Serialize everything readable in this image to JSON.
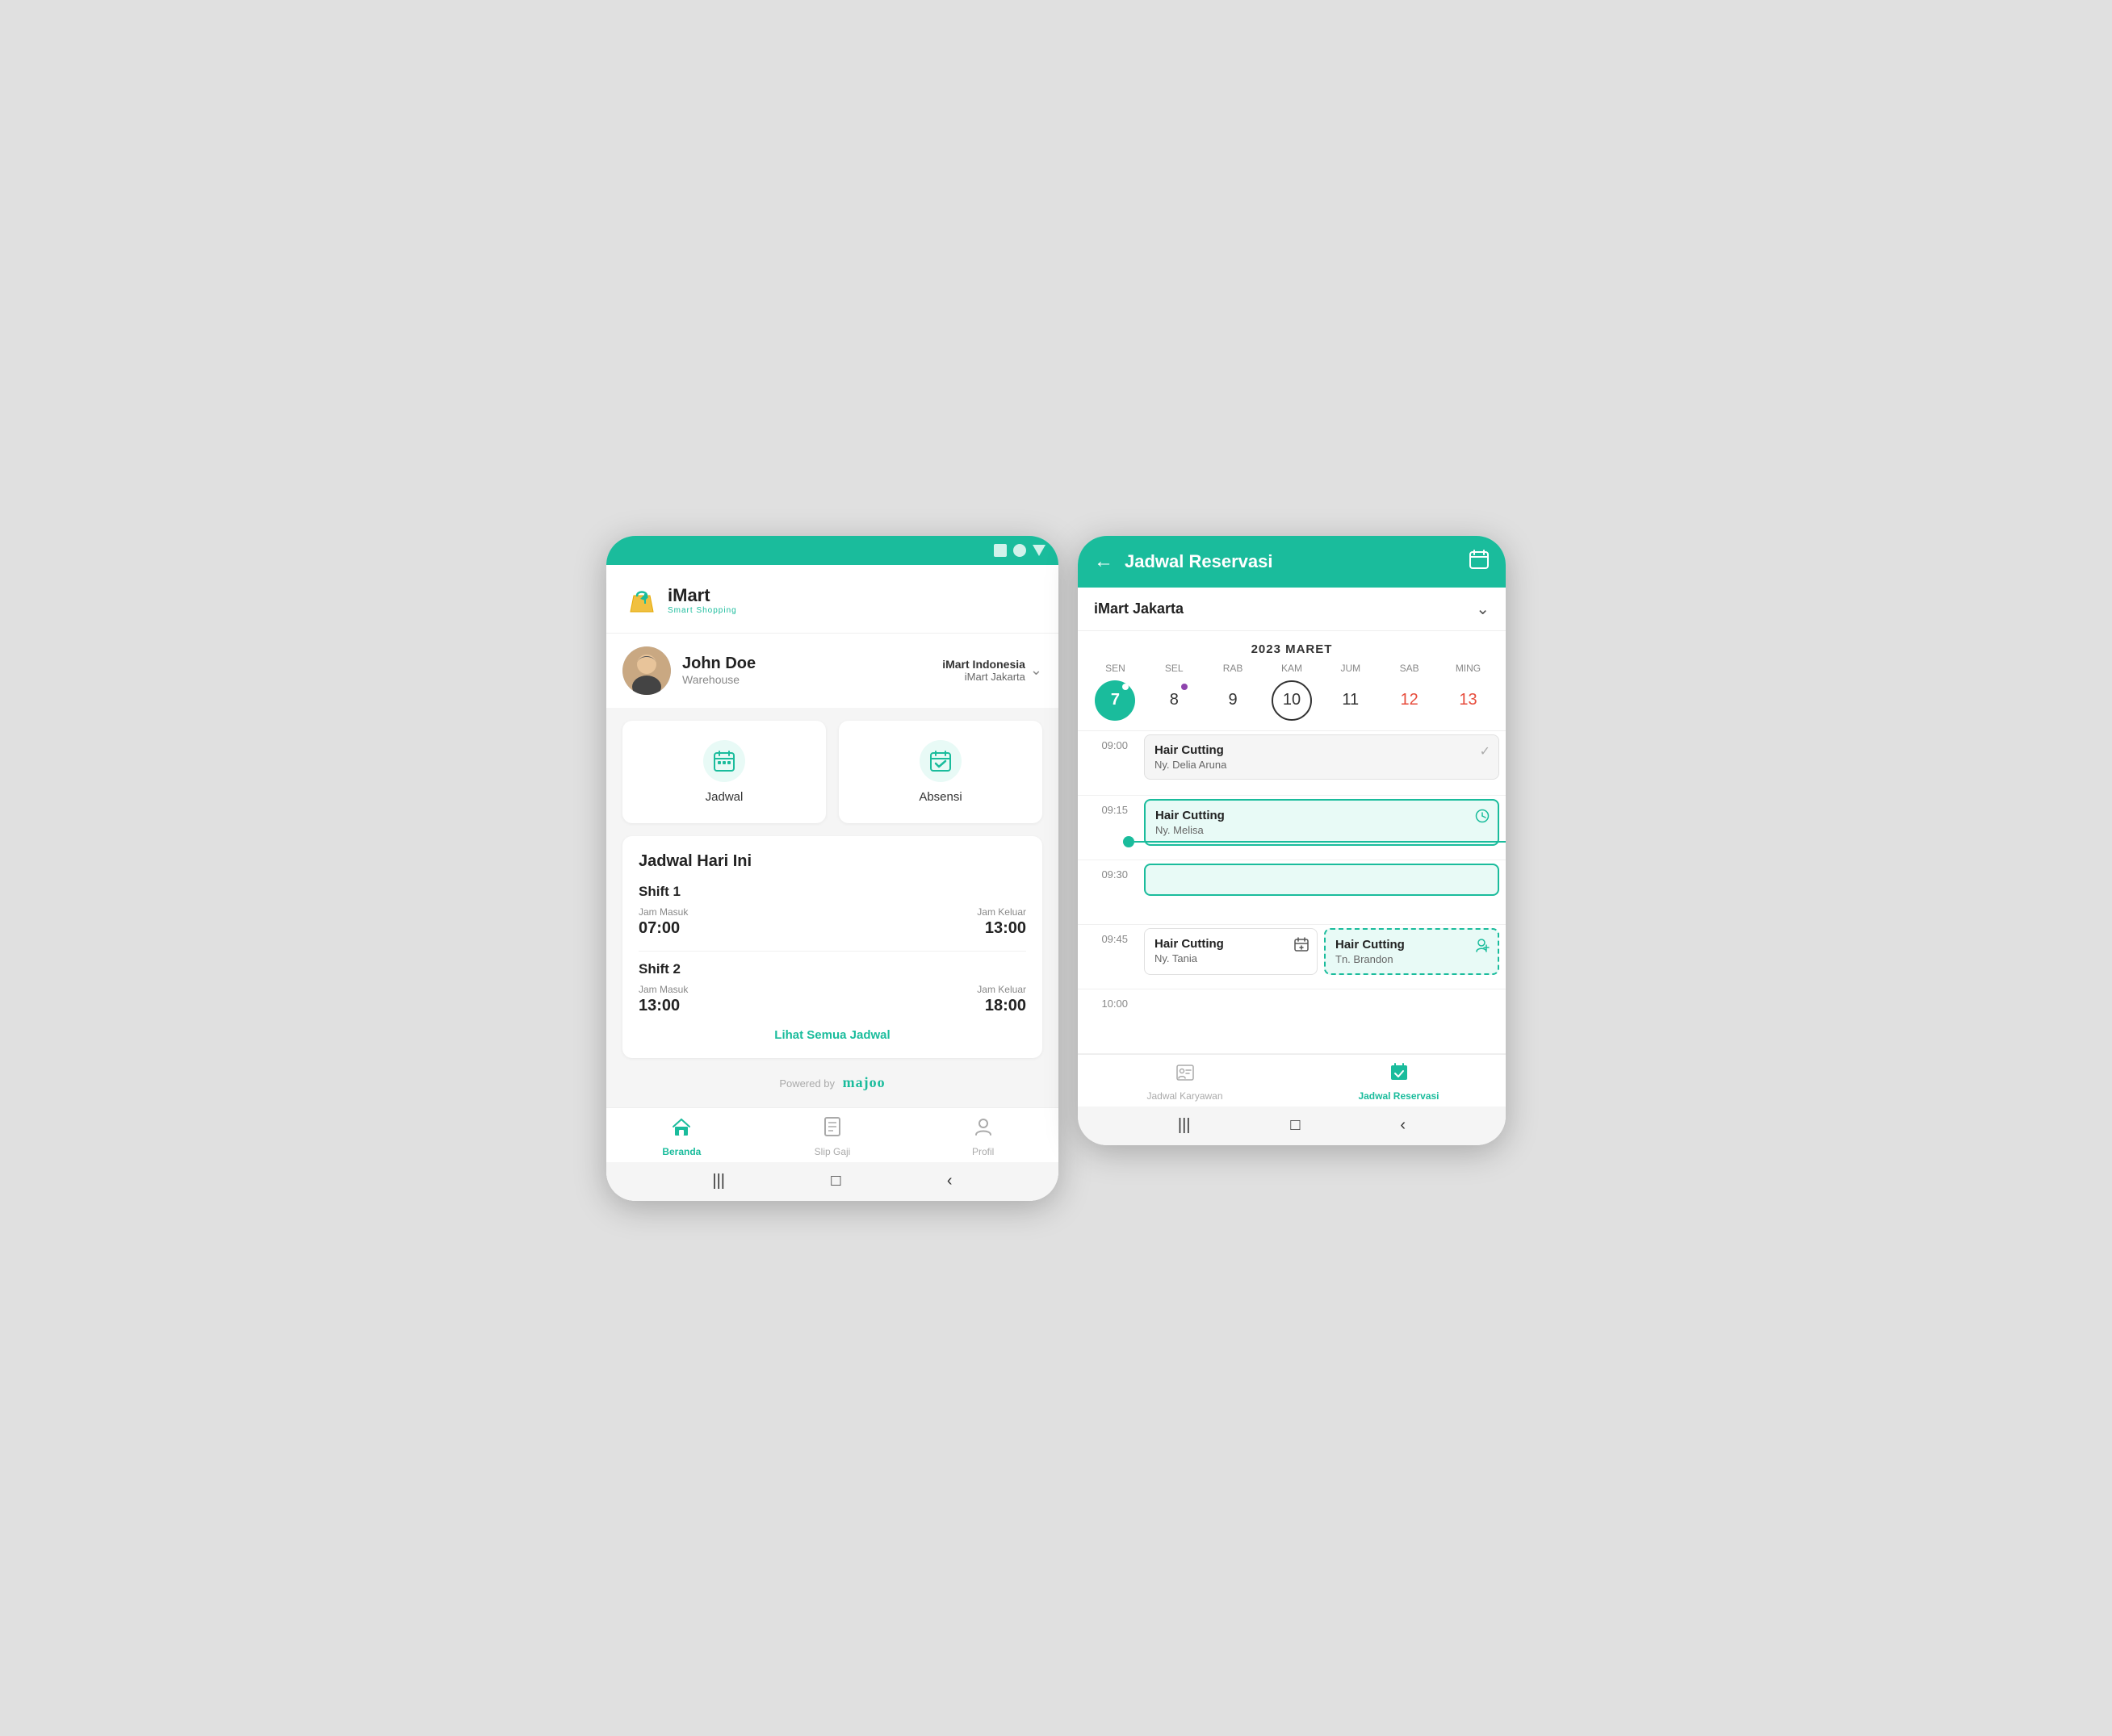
{
  "screen1": {
    "statusBar": {
      "icons": [
        "square",
        "circle",
        "triangle"
      ]
    },
    "header": {
      "logoText": "iMart",
      "logoSubText": "Smart Shopping"
    },
    "user": {
      "name": "John Doe",
      "role": "Warehouse",
      "companyName": "iMart Indonesia",
      "companyBranch": "iMart Jakarta"
    },
    "actions": [
      {
        "id": "jadwal",
        "label": "Jadwal"
      },
      {
        "id": "absensi",
        "label": "Absensi"
      }
    ],
    "schedule": {
      "title": "Jadwal Hari Ini",
      "shifts": [
        {
          "name": "Shift 1",
          "jamMasukLabel": "Jam Masuk",
          "jamMasuk": "07:00",
          "jamKeluarLabel": "Jam Keluar",
          "jamKeluar": "13:00"
        },
        {
          "name": "Shift 2",
          "jamMasukLabel": "Jam Masuk",
          "jamMasuk": "13:00",
          "jamKeluarLabel": "Jam Keluar",
          "jamKeluar": "18:00"
        }
      ],
      "lihatSemua": "Lihat Semua Jadwal"
    },
    "poweredBy": "Powered by",
    "poweredByBrand": "majoo",
    "bottomNav": [
      {
        "id": "beranda",
        "label": "Beranda",
        "active": true
      },
      {
        "id": "slip-gaji",
        "label": "Slip Gaji",
        "active": false
      },
      {
        "id": "profil",
        "label": "Profil",
        "active": false
      }
    ]
  },
  "screen2": {
    "topBar": {
      "title": "Jadwal Reservasi",
      "backLabel": "←",
      "calIcon": "📅"
    },
    "locationPicker": {
      "name": "iMart Jakarta"
    },
    "calendar": {
      "monthYear": "2023 MARET",
      "dayNames": [
        "SEN",
        "SEL",
        "RAB",
        "KAM",
        "JUM",
        "SAB",
        "MING"
      ],
      "dates": [
        {
          "num": "7",
          "active": true,
          "dot": "green",
          "isToday": false
        },
        {
          "num": "8",
          "active": false,
          "dot": "purple",
          "isToday": false
        },
        {
          "num": "9",
          "active": false,
          "dot": null,
          "isToday": false
        },
        {
          "num": "10",
          "active": false,
          "dot": null,
          "isToday": true
        },
        {
          "num": "11",
          "active": false,
          "dot": null,
          "isToday": false
        },
        {
          "num": "12",
          "active": false,
          "dot": null,
          "isToday": false,
          "red": true
        },
        {
          "num": "13",
          "active": false,
          "dot": null,
          "isToday": false,
          "red": true
        }
      ]
    },
    "timeline": [
      {
        "time": "09:00",
        "events": [
          {
            "title": "Hair Cutting",
            "customer": "Ny. Delia Aruna",
            "type": "grey",
            "icon": "✓",
            "iconType": "check"
          }
        ]
      },
      {
        "time": "09:15",
        "indicator": true,
        "events": [
          {
            "title": "Hair Cutting",
            "customer": "Ny. Melisa",
            "type": "teal",
            "icon": "🕐",
            "iconType": "clock"
          }
        ]
      },
      {
        "time": "09:30",
        "events": []
      },
      {
        "time": "09:45",
        "events": [
          {
            "title": "Hair Cutting",
            "customer": "Ny. Tania",
            "type": "white",
            "icon": "📋",
            "iconType": "calendar-add"
          },
          {
            "title": "Hair Cutting",
            "customer": "Tn. Brandon",
            "type": "dashed",
            "icon": "👤",
            "iconType": "person-add"
          }
        ]
      },
      {
        "time": "10:00",
        "events": []
      }
    ],
    "bottomNav": [
      {
        "id": "jadwal-karyawan",
        "label": "Jadwal Karyawan",
        "active": false
      },
      {
        "id": "jadwal-reservasi",
        "label": "Jadwal Reservasi",
        "active": true
      }
    ]
  }
}
